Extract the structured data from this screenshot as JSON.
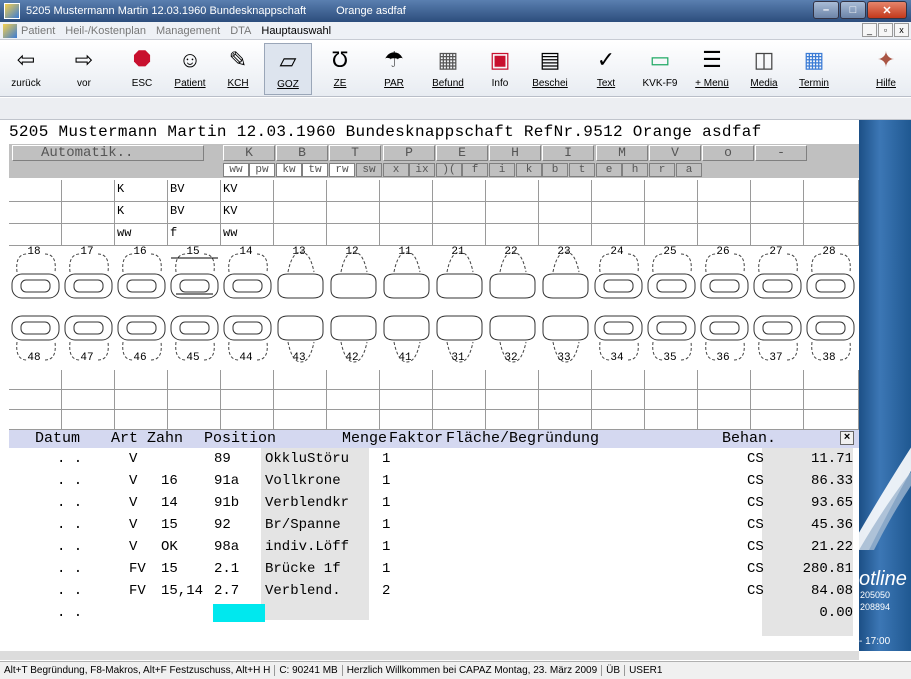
{
  "window": {
    "title": "5205 Mustermann Martin 12.03.1960 Bundesknappschaft",
    "title_extra": "Orange  asdfaf"
  },
  "menu": {
    "items": [
      "Patient",
      "Heil-/Kostenplan",
      "Management",
      "DTA",
      "Hauptauswahl"
    ]
  },
  "toolbar": {
    "buttons": [
      {
        "label": "zurück",
        "icon": "arrow-left-icon"
      },
      {
        "label": "vor",
        "icon": "arrow-right-icon"
      },
      {
        "label": "ESC",
        "icon": "stop-sign-icon"
      },
      {
        "label": "Patient",
        "icon": "patient-icon"
      },
      {
        "label": "KCH",
        "icon": "kch-icon"
      },
      {
        "label": "GOZ",
        "icon": "goz-icon"
      },
      {
        "label": "ZE",
        "icon": "horseshoe-icon"
      },
      {
        "label": "PAR",
        "icon": "par-icon"
      },
      {
        "label": "Befund",
        "icon": "befund-icon"
      },
      {
        "label": "Info",
        "icon": "info-icon"
      },
      {
        "label": "Beschei",
        "icon": "bescheid-icon"
      },
      {
        "label": "Text",
        "icon": "spellcheck-icon"
      },
      {
        "label": "KVK-F9",
        "icon": "card-icon"
      },
      {
        "label": "+ Menü",
        "icon": "menu-icon"
      },
      {
        "label": "Media",
        "icon": "media-icon"
      },
      {
        "label": "Termin",
        "icon": "calendar-icon"
      },
      {
        "label": "Hilfe",
        "icon": "help-icon"
      }
    ]
  },
  "patient_line": "5205 Mustermann Martin 12.03.1960  Bundesknappschaft RefNr.9512  Orange   asdfaf",
  "header": {
    "automatik": "Automatik..",
    "columns": [
      "K",
      "B",
      "T",
      "P",
      "E",
      "H",
      "I",
      "M",
      "V",
      "o",
      "-"
    ],
    "subcolumns": [
      "ww",
      "pw",
      "kw",
      "tw",
      "rw",
      "sw",
      "x",
      "ix",
      ")(",
      "f",
      "i",
      "k",
      "b",
      "t",
      "e",
      "h",
      "r",
      "a"
    ]
  },
  "upper_rows": [
    [
      "",
      "",
      "K",
      "BV",
      "KV"
    ],
    [
      "",
      "",
      "K",
      "BV",
      "KV"
    ],
    [
      "",
      "",
      "ww",
      "f",
      "ww"
    ]
  ],
  "teeth": {
    "upper": [
      "18",
      "17",
      "16",
      "15",
      "14",
      "13",
      "12",
      "11",
      "21",
      "22",
      "23",
      "24",
      "25",
      "26",
      "27",
      "28"
    ],
    "lower": [
      "48",
      "47",
      "46",
      "45",
      "44",
      "43",
      "42",
      "41",
      "31",
      "32",
      "33",
      "34",
      "35",
      "36",
      "37",
      "38"
    ]
  },
  "positions_header": {
    "datum": "Datum",
    "art": "Art",
    "zahn": "Zahn",
    "position": "Position",
    "menge": "Menge",
    "faktor": "Faktor",
    "flaeche": "Fläche/Begründung",
    "behan": "Behan.",
    "close": "×"
  },
  "positions": [
    {
      "datum": ".   .",
      "art": "V",
      "zahn": "",
      "pos": "89",
      "text": "OkkluStöru",
      "menge": "1",
      "behan": "CS",
      "betrag": "11.71"
    },
    {
      "datum": ".   .",
      "art": "V",
      "zahn": "16",
      "pos": "91a",
      "text": "Vollkrone",
      "menge": "1",
      "behan": "CS",
      "betrag": "86.33"
    },
    {
      "datum": ".   .",
      "art": "V",
      "zahn": "14",
      "pos": "91b",
      "text": "Verblendkr",
      "menge": "1",
      "behan": "CS",
      "betrag": "93.65"
    },
    {
      "datum": ".   .",
      "art": "V",
      "zahn": "15",
      "pos": "92",
      "text": "Br/Spanne",
      "menge": "1",
      "behan": "CS",
      "betrag": "45.36"
    },
    {
      "datum": ".   .",
      "art": "V",
      "zahn": "OK",
      "pos": "98a",
      "text": "indiv.Löff",
      "menge": "1",
      "behan": "CS",
      "betrag": "21.22"
    },
    {
      "datum": ".   .",
      "art": "FV",
      "zahn": "15",
      "pos": "2.1",
      "text": "Brücke 1f",
      "menge": "1",
      "behan": "CS",
      "betrag": "280.81"
    },
    {
      "datum": ".   .",
      "art": "FV",
      "zahn": "15,14",
      "pos": "2.7",
      "text": "Verblend.",
      "menge": "2",
      "behan": "CS",
      "betrag": "84.08"
    },
    {
      "datum": ".   .",
      "art": "",
      "zahn": "",
      "pos": "",
      "text": "",
      "menge": "",
      "behan": "",
      "betrag": "0.00"
    }
  ],
  "sidebar": {
    "logo": "otline",
    "num1": "205050",
    "num2": "208894",
    "time": "- 17:00"
  },
  "statusbar": {
    "hint": "Alt+T Begründung, F8-Makros, Alt+F Festzuschuss, Alt+H H",
    "mem": "C: 90241 MB",
    "welcome": "Herzlich Willkommen bei CAPAZ Montag, 23. März 2009",
    "ub": "ÜB",
    "user": "USER1"
  },
  "colors": {
    "titlebar": "#2c4d7c",
    "header_grey": "#c0c0c0",
    "positions_header": "#d4d8f0",
    "input_cyan": "#00e8ee",
    "sidebar": "#1f5891"
  }
}
